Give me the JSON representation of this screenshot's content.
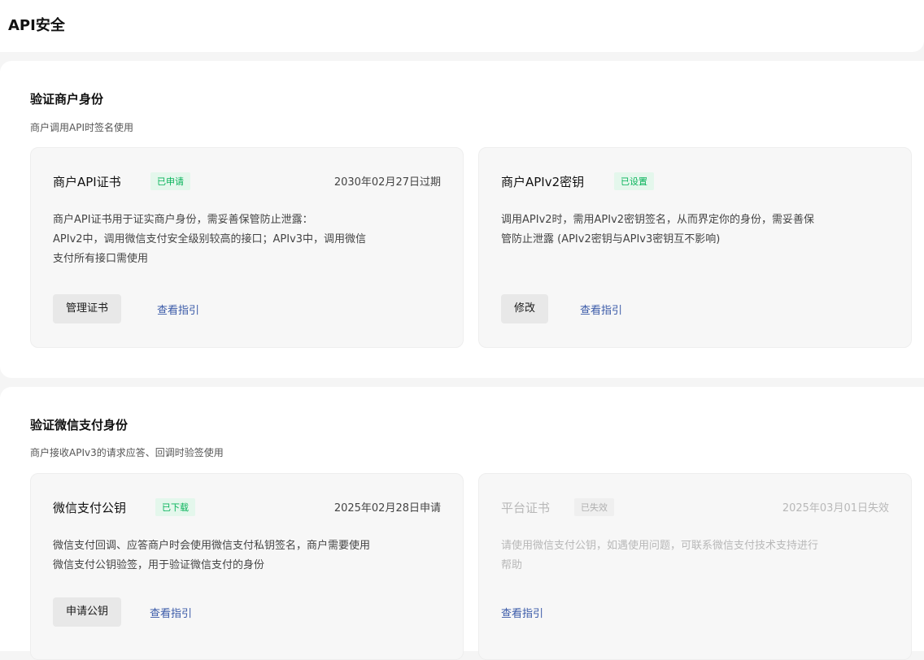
{
  "page": {
    "title": "API安全"
  },
  "sections": [
    {
      "title": "验证商户身份",
      "desc": "商户调用API时签名使用",
      "cards": [
        {
          "title": "商户API证书",
          "badge": "已申请",
          "date": "2030年02月27日过期",
          "desc": [
            "商户API证书用于证实商户身份，需妥善保管防止泄露：",
            "APIv2中，调用微信支付安全级别较高的接口；APIv3中，调用微信",
            "支付所有接口需使用"
          ],
          "button": "管理证书",
          "link": "查看指引"
        },
        {
          "title": "商户APIv2密钥",
          "badge": "已设置",
          "desc": [
            "调用APIv2时，需用APIv2密钥签名，从而界定你的身份，需妥善保",
            "管防止泄露 (APIv2密钥与APIv3密钥互不影响)"
          ],
          "button": "修改",
          "link": "查看指引"
        }
      ]
    },
    {
      "title": "验证微信支付身份",
      "desc": "商户接收APIv3的请求应答、回调时验签使用",
      "cards": [
        {
          "title": "微信支付公钥",
          "badge": "已下载",
          "date": "2025年02月28日申请",
          "desc": [
            "微信支付回调、应答商户时会使用微信支付私钥签名，商户需要使用",
            "微信支付公钥验签，用于验证微信支付的身份"
          ],
          "button": "申请公钥",
          "link": "查看指引"
        },
        {
          "title": "平台证书",
          "badge": "已失效",
          "date": "2025年03月01日失效",
          "desc": [
            "请使用微信支付公钥，如遇使用问题，可联系微信支付技术支持进行",
            "帮助"
          ],
          "link": "查看指引"
        }
      ]
    }
  ]
}
